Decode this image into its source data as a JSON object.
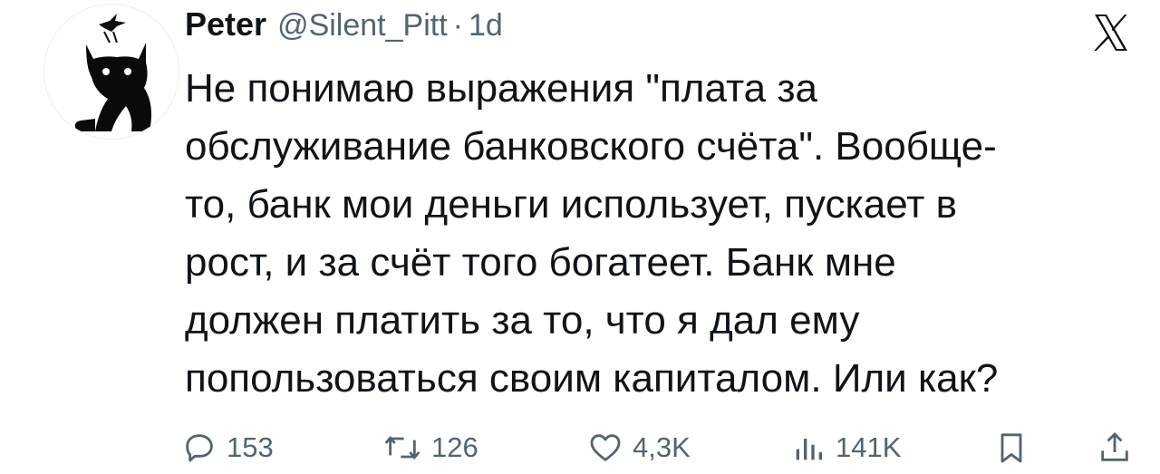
{
  "tweet": {
    "author": {
      "display_name": "Peter",
      "handle": "@Silent_Pitt",
      "separator": "·",
      "time_ago": "1d",
      "avatar_icon": "black-cat-silhouette-icon"
    },
    "text_lines": [
      "Не понимаю выражения \"плата за",
      "обслуживание банковского счёта\". Вообще-",
      "то, банк мои деньги использует, пускает в",
      "рост, и за счёт того богатеет. Банк мне",
      "должен платить за то, что я дал ему",
      "попользоваться своим капиталом. Или как?"
    ],
    "actions": {
      "replies": {
        "icon": "reply-icon",
        "count": "153"
      },
      "reposts": {
        "icon": "repost-icon",
        "count": "126"
      },
      "likes": {
        "icon": "heart-icon",
        "count": "4,3K"
      },
      "views": {
        "icon": "views-icon",
        "count": "141K"
      },
      "bookmark": {
        "icon": "bookmark-icon"
      },
      "share": {
        "icon": "share-icon"
      }
    }
  },
  "brand": {
    "logo_icon": "x-logo-icon"
  },
  "colors": {
    "text": "#0f1419",
    "secondary": "#536471",
    "background": "#ffffff"
  }
}
